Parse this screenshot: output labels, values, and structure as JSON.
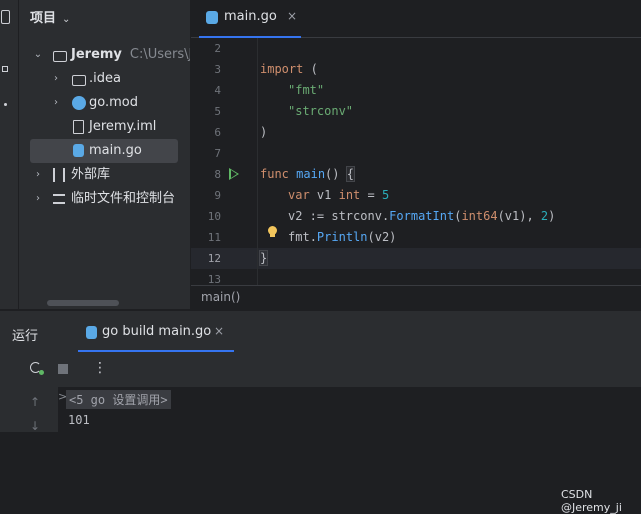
{
  "project": {
    "header": "项目",
    "tree": [
      {
        "label": "Jeremy",
        "path": "C:\\Users\\Jer",
        "icon": "folder-icon",
        "expanded": true
      },
      {
        "label": ".idea",
        "icon": "folder-icon"
      },
      {
        "label": "go.mod",
        "icon": "go-mod-icon"
      },
      {
        "label": "Jeremy.iml",
        "icon": "iml-file-icon"
      },
      {
        "label": "main.go",
        "icon": "go-file-icon",
        "selected": true
      },
      {
        "label": "外部库",
        "icon": "library-icon"
      },
      {
        "label": "临时文件和控制台",
        "icon": "scratch-icon"
      }
    ]
  },
  "editor": {
    "tab_label": "main.go",
    "tab_close": "×",
    "line_numbers": [
      "2",
      "3",
      "4",
      "5",
      "6",
      "7",
      "8",
      "9",
      "10",
      "11",
      "12",
      "13"
    ],
    "current_line": "12",
    "code": {
      "l3_kw": "import",
      "l3_rest": " (",
      "l4": "\"fmt\"",
      "l5": "\"strconv\"",
      "l6": ")",
      "l8_kw": "func",
      "l8_fn": "main",
      "l8_paren": "() ",
      "l8_brace": "{",
      "l9_kw": "var",
      "l9_mid": " v1 ",
      "l9_type": "int",
      "l9_eq": " = ",
      "l9_num": "5",
      "l10_a": "v2 := ",
      "l10_pkg": "strconv",
      "l10_dot": ".",
      "l10_fn": "FormatInt",
      "l10_open": "(",
      "l10_type": "int64",
      "l10_mid": "(v1), ",
      "l10_num": "2",
      "l10_close": ")",
      "l11_pkg": "fmt",
      "l11_dot": ".",
      "l11_fn": "Println",
      "l11_rest": "(v2)",
      "l12": "}"
    },
    "breadcrumb": "main()"
  },
  "run": {
    "title": "运行",
    "tab_label": "go build main.go",
    "tab_close": "×",
    "more": "⋮",
    "console_caret": ">",
    "console_lines": [
      "<5 go 设置调用>",
      "101"
    ]
  },
  "watermark": "CSDN @Jeremy_ji",
  "colors": {
    "accent": "#3574f0",
    "run_green": "#5fb865",
    "bulb": "#f2c55c",
    "go_blue": "#5aa9e6"
  }
}
